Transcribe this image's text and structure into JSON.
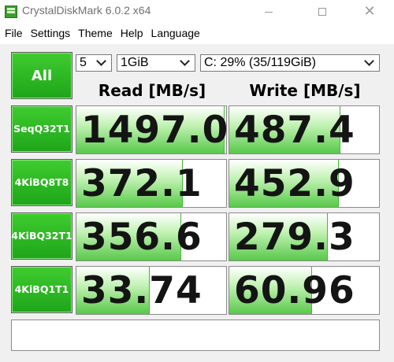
{
  "window": {
    "title": "CrystalDiskMark 6.0.2 x64"
  },
  "menu": [
    "File",
    "Settings",
    "Theme",
    "Help",
    "Language"
  ],
  "controls": {
    "all_label": "All",
    "test_count": "5",
    "test_size": "1GiB",
    "drive": "C: 29% (35/119GiB)"
  },
  "headers": {
    "read": "Read [MB/s]",
    "write": "Write [MB/s]"
  },
  "tests": [
    {
      "line1": "Seq",
      "line2": "Q32T1",
      "read": "1497.0",
      "write": "487.4",
      "read_fill": 0.99,
      "write_fill": 0.74
    },
    {
      "line1": "4KiB",
      "line2": "Q8T8",
      "read": "372.1",
      "write": "452.9",
      "read_fill": 0.71,
      "write_fill": 0.73
    },
    {
      "line1": "4KiB",
      "line2": "Q32T1",
      "read": "356.6",
      "write": "279.3",
      "read_fill": 0.7,
      "write_fill": 0.66
    },
    {
      "line1": "4KiB",
      "line2": "Q1T1",
      "read": "33.74",
      "write": "60.96",
      "read_fill": 0.49,
      "write_fill": 0.55
    }
  ],
  "colors": {
    "accent_green": "#1ea51a",
    "bar_green": "#58c94a"
  }
}
